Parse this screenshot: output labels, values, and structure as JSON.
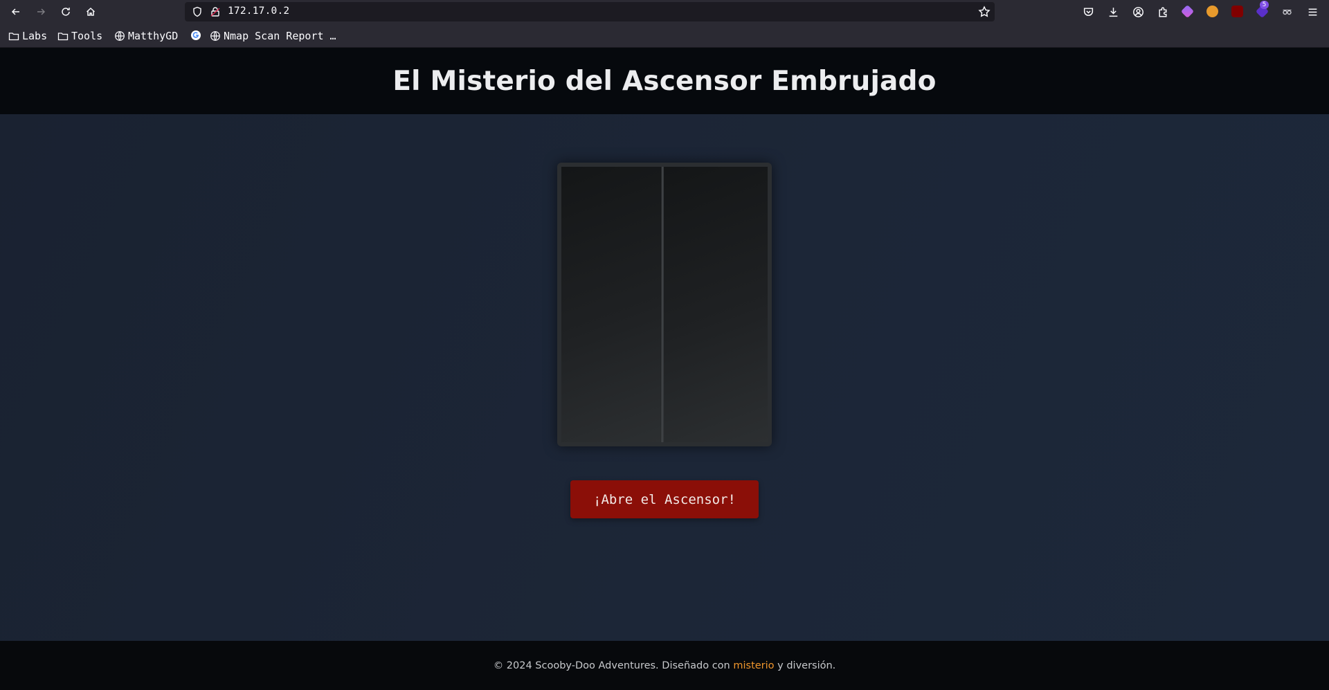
{
  "browser": {
    "url": "172.17.0.2",
    "bookmarks": [
      {
        "label": "Labs",
        "icon": "folder-icon"
      },
      {
        "label": "Tools",
        "icon": "folder-icon"
      },
      {
        "label": "MatthyGD",
        "icon": "globe-icon"
      },
      {
        "label": "",
        "icon": "google-icon"
      },
      {
        "label": "Nmap Scan Report …",
        "icon": "globe-icon"
      }
    ],
    "extension_badge": "5"
  },
  "page": {
    "title": "El Misterio del Ascensor Embrujado",
    "open_button_label": "¡Abre el Ascensor!",
    "footer": {
      "prefix": "© 2024 Scooby-Doo Adventures. Diseñado con ",
      "link_text": "misterio",
      "suffix": " y diversión."
    }
  },
  "colors": {
    "header_bg": "#06090d",
    "main_bg": "#1c2533",
    "button_bg": "#8b0f08",
    "link_accent": "#f0962c"
  }
}
